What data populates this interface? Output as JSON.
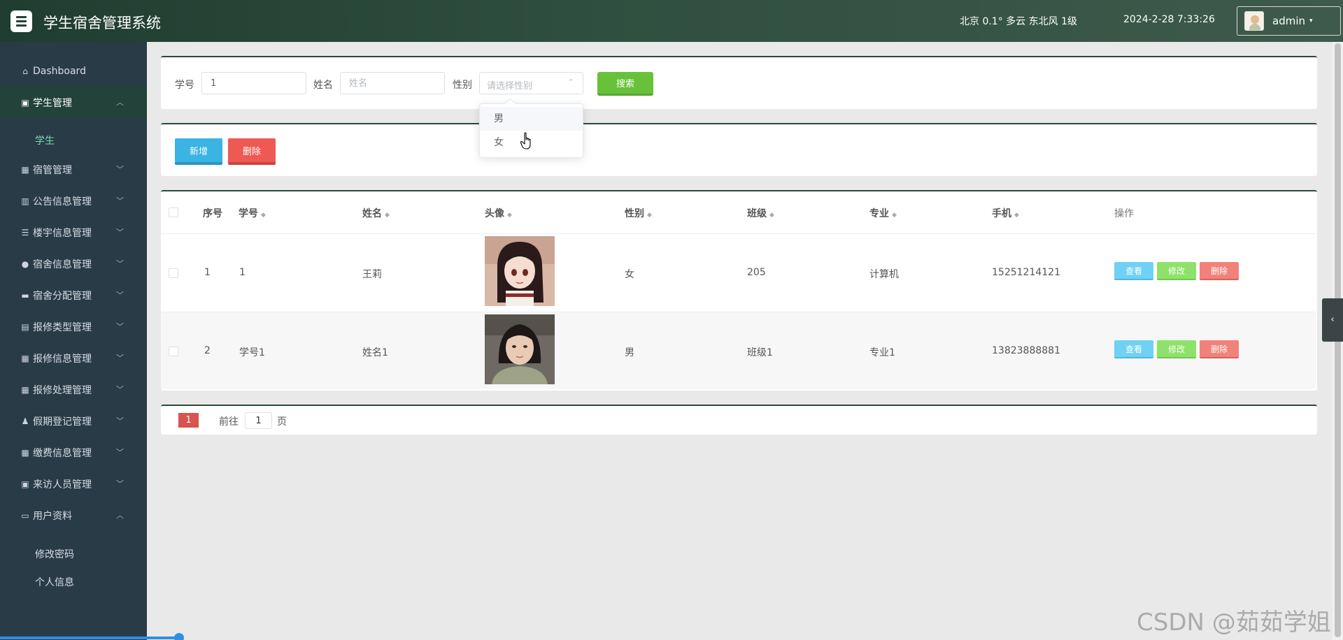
{
  "header": {
    "title": "学生宿舍管理系统",
    "weather": "北京  0.1°  多云  东北风  1级",
    "datetime": "2024-2-28 7:33:26",
    "username": "admin",
    "caret": "▾"
  },
  "sidebar": {
    "dashboard": "Dashboard",
    "items": [
      {
        "label": "学生管理",
        "icon": "clipboard-icon"
      },
      {
        "label": "宿管管理",
        "icon": "grid-icon"
      },
      {
        "label": "公告信息管理",
        "icon": "bar-chart-icon"
      },
      {
        "label": "楼宇信息管理",
        "icon": "list-icon"
      },
      {
        "label": "宿舍信息管理",
        "icon": "location-pin-icon"
      },
      {
        "label": "宿舍分配管理",
        "icon": "chat-bubble-icon"
      },
      {
        "label": "报修类型管理",
        "icon": "briefcase-icon"
      },
      {
        "label": "报修信息管理",
        "icon": "grid-icon"
      },
      {
        "label": "报修处理管理",
        "icon": "grid-icon"
      },
      {
        "label": "假期登记管理",
        "icon": "person-icon"
      },
      {
        "label": "缴费信息管理",
        "icon": "grid-icon"
      },
      {
        "label": "来访人员管理",
        "icon": "clipboard-icon"
      },
      {
        "label": "用户资料",
        "icon": "id-card-icon"
      }
    ],
    "sub_student": "学生",
    "sub_password": "修改密码",
    "sub_profile": "个人信息"
  },
  "search": {
    "id_label": "学号",
    "id_value": "1",
    "name_label": "姓名",
    "name_placeholder": "姓名",
    "gender_label": "性别",
    "gender_placeholder": "请选择性别",
    "button": "搜索"
  },
  "dropdown": {
    "options": [
      "男",
      "女"
    ]
  },
  "actions": {
    "add": "新增",
    "delete": "删除"
  },
  "table": {
    "headers": [
      "序号",
      "学号",
      "姓名",
      "头像",
      "性别",
      "班级",
      "专业",
      "手机",
      "操作"
    ],
    "rows": [
      {
        "index": "1",
        "student_id": "1",
        "name": "王莉",
        "gender": "女",
        "class": "205",
        "major": "计算机",
        "phone": "15251214121"
      },
      {
        "index": "2",
        "student_id": "学号1",
        "name": "姓名1",
        "gender": "男",
        "class": "班级1",
        "major": "专业1",
        "phone": "13823888881"
      }
    ],
    "btn_view": "查看",
    "btn_edit": "修改",
    "btn_delete": "删除"
  },
  "pager": {
    "current": "1",
    "goto_label": "前往",
    "goto_value": "1",
    "page_label": "页"
  },
  "right_tab_icon": "‹",
  "watermark": "CSDN @茹茹学姐",
  "colors": {
    "header_bg": "#2f4f40",
    "sidebar_bg": "#2a3b48",
    "search_btn": "#67c23a",
    "add_btn": "#3ab4e2",
    "delete_btn": "#ee5a53",
    "page_active": "#d9534f"
  }
}
